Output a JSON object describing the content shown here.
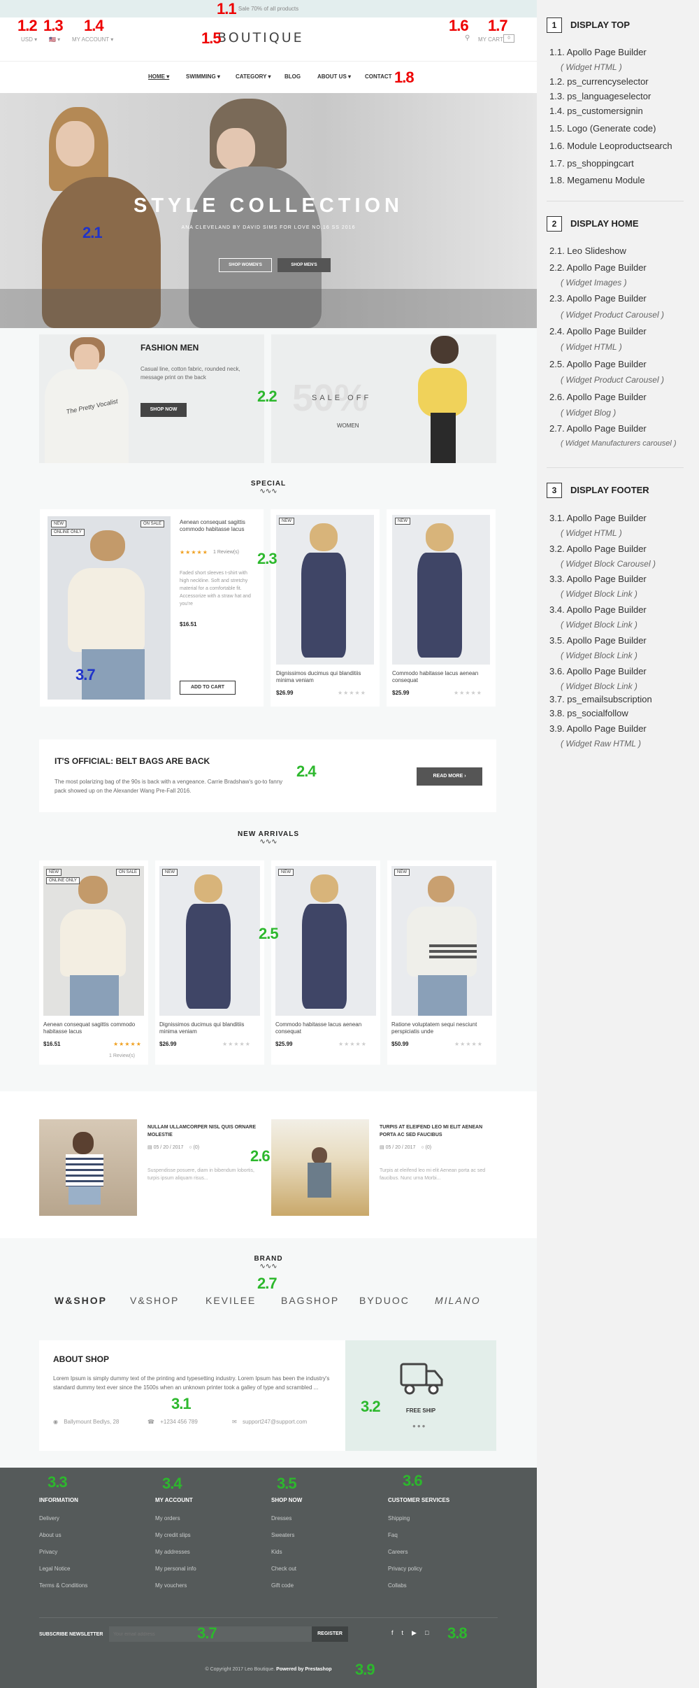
{
  "labels": {
    "l1_1": "1.1",
    "l1_2": "1.2",
    "l1_3": "1.3",
    "l1_4": "1.4",
    "l1_5": "1.5",
    "l1_6": "1.6",
    "l1_7": "1.7",
    "l1_8": "1.8",
    "l2_1": "2.1",
    "l2_2": "2.2",
    "l2_3": "2.3",
    "l2_4": "2.4",
    "l2_5": "2.5",
    "l2_6": "2.6",
    "l2_7": "2.7",
    "l3_1": "3.1",
    "l3_2": "3.2",
    "l3_3": "3.3",
    "l3_4": "3.4",
    "l3_5": "3.5",
    "l3_6": "3.6",
    "l3_7": "3.7",
    "l3_8": "3.8",
    "l3_9": "3.9",
    "l3_7b": "3.7"
  },
  "topbar": {
    "text": "Sale 70% of all products"
  },
  "header": {
    "currency": "USD ▾",
    "language": "🇺🇸 ▾",
    "account": "MY ACCOUNT ▾",
    "logo": "BOUTIQUE",
    "cart": "MY CART",
    "cart_count": "0"
  },
  "nav": {
    "items": [
      "HOME ▾",
      "SWIMMING ▾",
      "CATEGORY ▾",
      "BLOG",
      "ABOUT US ▾",
      "CONTACT"
    ]
  },
  "hero": {
    "title": "STYLE COLLECTION",
    "subtitle": "ANA CLEVELAND BY DAVID SIMS FOR LOVE NO.16 SS 2016",
    "btn_women": "SHOP WOMEN'S",
    "btn_men": "SHOP MEN'S"
  },
  "banner_men": {
    "title": "FASHION MEN",
    "text": "Casual line, cotton fabric, rounded neck, message print on the back",
    "btn": "SHOP NOW",
    "tshirt_print": "The Pretty Vocalist"
  },
  "banner_sale": {
    "big": "50%",
    "text": "SALE OFF",
    "sub": "WOMEN"
  },
  "special": {
    "title": "SPECIAL",
    "wave": "∿∿∿"
  },
  "featured": {
    "tag_new": "NEW",
    "tag_online": "ONLINE ONLY",
    "tag_sale": "ON SALE",
    "title": "Aenean consequat sagittis commodo habitasse lacus",
    "stars": "★★★★★",
    "reviews": "1 Review(s)",
    "desc": "Faded short sleeves t-shirt with high neckline. Soft and stretchy material for a comfortable fit. Accessorize with a straw hat and you're",
    "price": "$16.51",
    "btn": "ADD TO CART"
  },
  "special_items": [
    {
      "tag": "NEW",
      "title": "Dignissimos ducimus qui blanditiis minima veniam",
      "price": "$26.99",
      "stars": "★★★★★"
    },
    {
      "tag": "NEW",
      "title": "Commodo habitasse lacus aenean consequat",
      "price": "$25.99",
      "stars": "★★★★★"
    }
  ],
  "official": {
    "title": "IT'S OFFICIAL: BELT BAGS ARE BACK",
    "text": "The most polarizing bag of the 90s is back with a vengeance. Carrie Bradshaw's go-to fanny pack showed up on the Alexander Wang Pre-Fall 2016.",
    "btn": "READ MORE ›"
  },
  "arrivals": {
    "title": "NEW ARRIVALS",
    "wave": "∿∿∿"
  },
  "arrival_items": [
    {
      "tag": "NEW",
      "tag2": "ONLINE ONLY",
      "tag3": "ON SALE",
      "title": "Aenean consequat sagittis commodo habitasse lacus",
      "price": "$16.51",
      "stars": "★★★★★",
      "reviews": "1 Review(s)"
    },
    {
      "tag": "NEW",
      "title": "Dignissimos ducimus qui blanditiis minima veniam",
      "price": "$26.99",
      "stars": "★★★★★"
    },
    {
      "tag": "NEW",
      "title": "Commodo habitasse lacus aenean consequat",
      "price": "$25.99",
      "stars": "★★★★★"
    },
    {
      "tag": "NEW",
      "title": "Ratione voluptatem sequi nesciunt perspiciatis unde",
      "price": "$50.99",
      "stars": "★★★★★"
    }
  ],
  "blog": [
    {
      "title": "NULLAM ULLAMCORPER NISL QUIS ORNARE MOLESTIE",
      "date": "05 / 20 / 2017",
      "comments": "(0)",
      "text": "Suspendisse posuere, diam in bibendum lobortis, turpis ipsum aliquam risus..."
    },
    {
      "title": "TURPIS AT ELEIFEND LEO MI ELIT AENEAN PORTA AC SED FAUCIBUS",
      "date": "05 / 20 / 2017",
      "comments": "(0)",
      "text": "Turpis at eleifend leo mi elit Aenean porta ac sed faucibus. Nunc urna Morbi..."
    }
  ],
  "brand": {
    "title": "BRAND",
    "wave": "∿∿∿",
    "items": [
      "W&SHOP",
      "V&SHOP",
      "KEVILEE",
      "BAGSHOP",
      "BYDUOC",
      "MILANO"
    ]
  },
  "about": {
    "title": "ABOUT SHOP",
    "text": "Lorem Ipsum is simply dummy text of the printing and typesetting industry. Lorem Ipsum has been the industry's standard dummy text ever since the 1500s when an unknown printer took a galley of type and scrambled ...",
    "address": "Ballymount Bedlys, 28",
    "phone": "+1234 456 789",
    "email": "support247@support.com"
  },
  "freeship": {
    "text": "FREE SHIP"
  },
  "footer": {
    "cols": [
      {
        "title": "INFORMATION",
        "links": [
          "Delivery",
          "About us",
          "Privacy",
          "Legal Notice",
          "Terms & Conditions"
        ]
      },
      {
        "title": "MY ACCOUNT",
        "links": [
          "My orders",
          "My credit slips",
          "My addresses",
          "My personal info",
          "My vouchers"
        ]
      },
      {
        "title": "SHOP NOW",
        "links": [
          "Dresses",
          "Sweaters",
          "Kids",
          "Check out",
          "Gift code"
        ]
      },
      {
        "title": "CUSTOMER SERVICES",
        "links": [
          "Shipping",
          "Faq",
          "Careers",
          "Privacy policy",
          "Collabs"
        ]
      }
    ],
    "newsletter_label": "SUBSCRIBE NEWSLETTER",
    "newsletter_placeholder": "Your email address",
    "register": "REGISTER",
    "copyright": "© Copyright 2017 Leo Boutique.",
    "powered": "Powered by Prestashop"
  },
  "panel": {
    "sections": [
      {
        "num": "1",
        "title": "DISPLAY TOP"
      },
      {
        "num": "2",
        "title": "DISPLAY HOME"
      },
      {
        "num": "3",
        "title": "DISPLAY FOOTER"
      }
    ],
    "top_items": [
      "1.1. Apollo Page Builder",
      "( Widget HTML )",
      "1.2. ps_currencyselector",
      "1.3. ps_languageselector",
      "1.4. ps_customersignin",
      "1.5. Logo (Generate code)",
      "1.6. Module Leoproductsearch",
      "1.7. ps_shoppingcart",
      "1.8. Megamenu Module"
    ],
    "home_items": [
      "2.1. Leo Slideshow",
      "2.2. Apollo Page Builder",
      "( Widget Images )",
      "2.3. Apollo Page Builder",
      "( Widget Product Carousel )",
      "2.4. Apollo Page Builder",
      "( Widget HTML )",
      "2.5. Apollo Page Builder",
      "( Widget Product Carousel )",
      "2.6. Apollo Page Builder",
      "( Widget Blog )",
      "2.7. Apollo Page Builder",
      "( Widget Manufacturers carousel )"
    ],
    "footer_items": [
      "3.1. Apollo Page Builder",
      "( Widget HTML )",
      "3.2. Apollo Page Builder",
      "( Widget Block Carousel )",
      "3.3. Apollo Page Builder",
      "( Widget Block Link )",
      "3.4. Apollo Page Builder",
      "( Widget Block Link )",
      "3.5. Apollo Page Builder",
      "( Widget Block Link )",
      "3.6. Apollo Page Builder",
      "( Widget Block Link )",
      "3.7. ps_emailsubscription",
      "3.8. ps_socialfollow",
      "3.9. Apollo Page Builder",
      "( Widget Raw HTML )"
    ]
  }
}
